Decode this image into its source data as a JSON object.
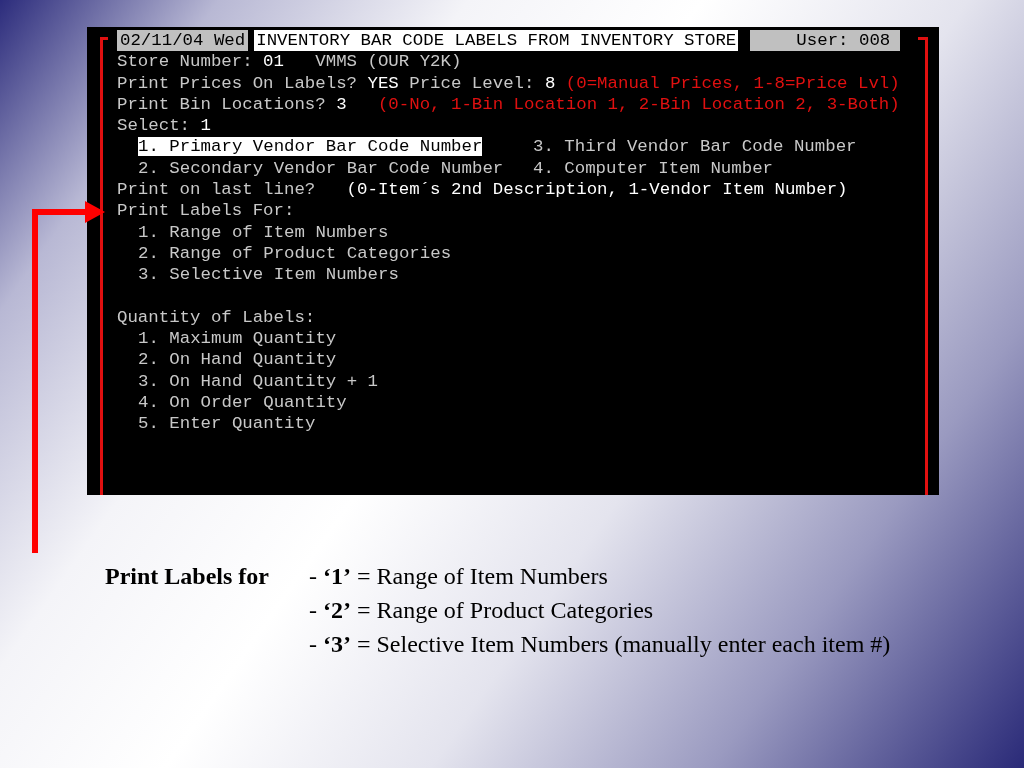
{
  "terminal": {
    "header": {
      "date": "02/11/04 Wed",
      "title": "INVENTORY BAR CODE LABELS FROM INVENTORY STORE",
      "user": "User: 008"
    },
    "lines": [
      {
        "kind": "text",
        "segments": [
          {
            "text": "Store Number: ",
            "kind": "normal"
          },
          {
            "text": "01",
            "kind": "bright"
          },
          {
            "text": "   VMMS (OUR Y2K)",
            "kind": "normal"
          }
        ]
      },
      {
        "kind": "text",
        "segments": [
          {
            "text": "Print Prices On Labels? ",
            "kind": "normal"
          },
          {
            "text": "YES",
            "kind": "bright"
          },
          {
            "text": " Price Level: ",
            "kind": "normal"
          },
          {
            "text": "8",
            "kind": "bright"
          },
          {
            "text": " (0=Manual Prices, 1-8=Price Lvl)",
            "kind": "red"
          }
        ]
      },
      {
        "kind": "text",
        "segments": [
          {
            "text": "Print Bin Locations? ",
            "kind": "normal"
          },
          {
            "text": "3",
            "kind": "bright"
          },
          {
            "text": "   (0-No, 1-Bin Location 1, 2-Bin Location 2, 3-Both)",
            "kind": "red"
          }
        ]
      },
      {
        "kind": "text",
        "segments": [
          {
            "text": "Select: ",
            "kind": "normal"
          },
          {
            "text": "1",
            "kind": "bright"
          }
        ]
      },
      {
        "kind": "pair",
        "options": [
          {
            "text": "1. Primary Vendor Bar Code Number",
            "selected": true
          },
          {
            "text": "3. Third Vendor Bar Code Number",
            "selected": false
          }
        ]
      },
      {
        "kind": "pair",
        "options": [
          {
            "text": "2. Secondary Vendor Bar Code Number",
            "selected": false
          },
          {
            "text": "4. Computer Item Number",
            "selected": false
          }
        ]
      },
      {
        "kind": "text",
        "segments": [
          {
            "text": "Print on last line?   ",
            "kind": "normal"
          },
          {
            "text": "(0-Item´s 2nd Description, 1-Vendor Item Number)",
            "kind": "bright"
          }
        ]
      },
      {
        "kind": "text",
        "segments": [
          {
            "text": "Print Labels For:",
            "kind": "normal"
          }
        ]
      },
      {
        "kind": "option",
        "text": "1. Range of Item Numbers"
      },
      {
        "kind": "option",
        "text": "2. Range of Product Categories"
      },
      {
        "kind": "option",
        "text": "3. Selective Item Numbers"
      },
      {
        "kind": "blank"
      },
      {
        "kind": "text",
        "segments": [
          {
            "text": "Quantity of Labels:",
            "kind": "normal"
          }
        ]
      },
      {
        "kind": "option",
        "text": "1. Maximum Quantity"
      },
      {
        "kind": "option",
        "text": "2. On Hand Quantity"
      },
      {
        "kind": "option",
        "text": "3. On Hand Quantity + 1"
      },
      {
        "kind": "option",
        "text": "4. On Order Quantity"
      },
      {
        "kind": "option",
        "text": "5. Enter Quantity"
      }
    ]
  },
  "caption": {
    "label": "Print Labels for",
    "items": [
      "- **‘1’** = Range of Item Numbers",
      "- **‘2’** = Range of Product Categories",
      "- **‘3’** = Selective Item Numbers (manually enter each item #)"
    ]
  }
}
